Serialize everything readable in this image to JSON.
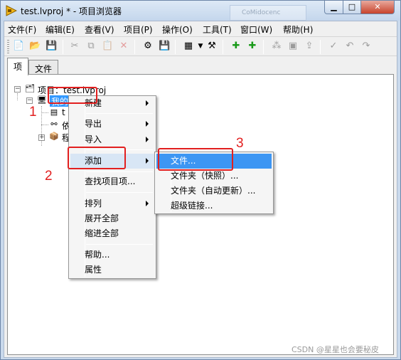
{
  "window": {
    "title": "test.lvproj * - 项目浏览器",
    "ghost_tab": "CoMidocenc",
    "minimize": "▁",
    "maximize": "□",
    "close": "✕"
  },
  "menubar": [
    "文件(F)",
    "编辑(E)",
    "查看(V)",
    "项目(P)",
    "操作(O)",
    "工具(T)",
    "窗口(W)",
    "帮助(H)"
  ],
  "toolbar": {
    "icons": [
      "new-icon",
      "open-icon",
      "save-all-icon",
      "cut-icon",
      "copy-icon",
      "paste-icon",
      "delete-icon",
      "build-icon",
      "save-icon",
      "view-icon",
      "dropdown-icon",
      "settings-icon",
      "add-icon",
      "add-folder-icon",
      "group-icon",
      "build-spec-icon",
      "deploy-icon",
      "check-icon",
      "undo-icon",
      "redo-icon"
    ]
  },
  "tabs": [
    "项",
    "文件"
  ],
  "tree": {
    "root": "项目：test.lvproj",
    "my_computer": "我的",
    "child1": "t",
    "child2": "依",
    "child3": "程"
  },
  "context_menu": {
    "items": [
      "新建",
      "导出",
      "导入",
      "添加",
      "查找项目项...",
      "排列",
      "展开全部",
      "缩进全部",
      "帮助...",
      "属性"
    ]
  },
  "submenu": {
    "items": [
      "文件...",
      "文件夹（快照）...",
      "文件夹（自动更新）...",
      "超级链接..."
    ]
  },
  "annotations": {
    "n1": "1",
    "n2": "2",
    "n3": "3"
  },
  "watermark": "CSDN @星星也会要秘皮",
  "colors": {
    "highlight": "#3d96f3",
    "annotation_red": "#e21f1f"
  }
}
